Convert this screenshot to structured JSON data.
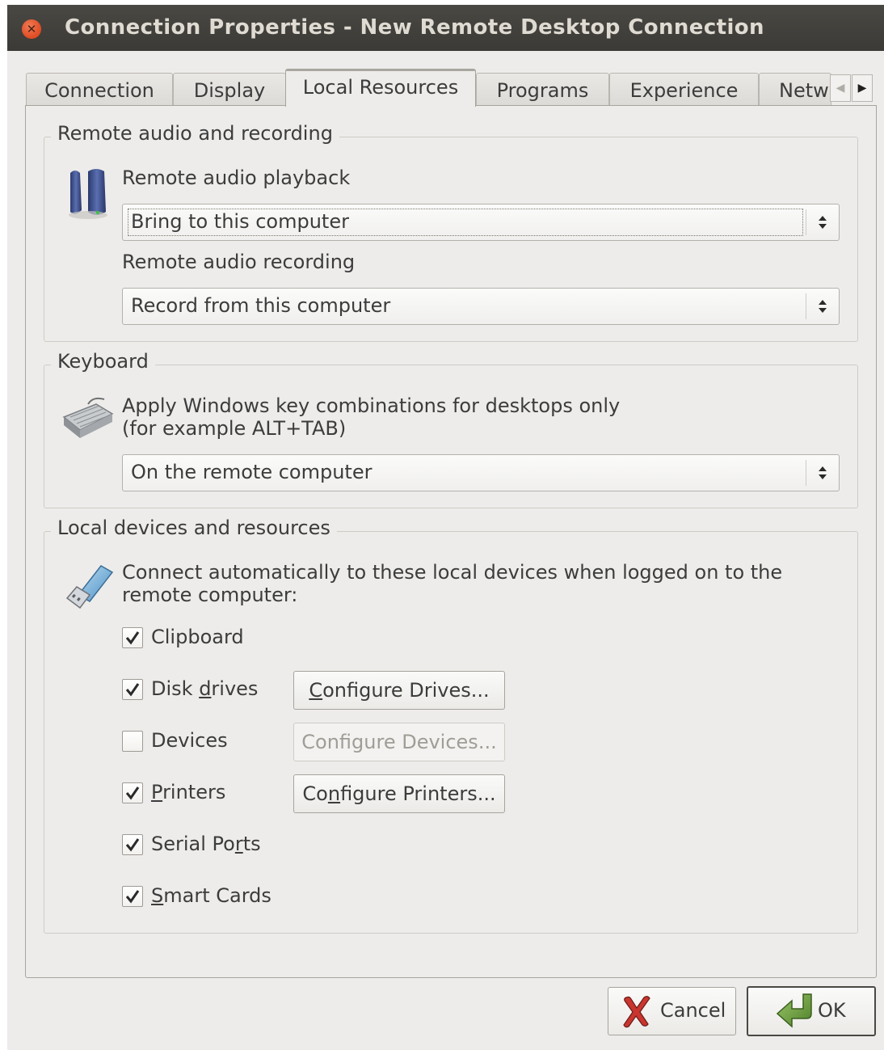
{
  "window": {
    "title": "Connection Properties - New Remote Desktop Connection"
  },
  "tabs": [
    {
      "label": "Connection"
    },
    {
      "label": "Display"
    },
    {
      "label": "Local Resources",
      "active": true
    },
    {
      "label": "Programs"
    },
    {
      "label": "Experience"
    },
    {
      "label": "Netw"
    }
  ],
  "audio": {
    "group_title": "Remote audio and recording",
    "playback_label": "Remote audio playback",
    "playback_value": "Bring to this computer",
    "recording_label": "Remote audio recording",
    "recording_value": "Record from this computer",
    "icon": "speakers-icon"
  },
  "keyboard": {
    "group_title": "Keyboard",
    "description_line1": "Apply Windows key combinations for desktops only",
    "description_line2": "(for example ALT+TAB)",
    "value": "On the remote computer",
    "icon": "keyboard-icon"
  },
  "devices": {
    "group_title": "Local devices and resources",
    "description_line1": "Connect automatically to these local devices when logged on to the",
    "description_line2": "remote computer:",
    "icon": "usb-drive-icon",
    "items": [
      {
        "label": "Clipboard",
        "checked": true
      },
      {
        "label_pre": "Disk ",
        "label_mn": "d",
        "label_post": "rives",
        "checked": true
      },
      {
        "label": "Devices",
        "checked": false
      },
      {
        "label_pre": "",
        "label_mn": "P",
        "label_post": "rinters",
        "checked": true
      },
      {
        "label_pre": "Serial Po",
        "label_mn": "r",
        "label_post": "ts",
        "checked": true
      },
      {
        "label_pre": "",
        "label_mn": "S",
        "label_post": "mart Cards",
        "checked": true
      }
    ],
    "configure_drives": {
      "pre": "",
      "mn": "C",
      "post": "onfigure Drives..."
    },
    "configure_devices": {
      "label": "Configure Devices...",
      "enabled": false
    },
    "configure_printers": {
      "pre": "Co",
      "mn": "n",
      "post": "figure Printers..."
    }
  },
  "buttons": {
    "cancel": "Cancel",
    "ok": "OK"
  },
  "colors": {
    "titlebar": "#3f3e3a",
    "close": "#e5522a",
    "window_bg": "#edecea"
  }
}
